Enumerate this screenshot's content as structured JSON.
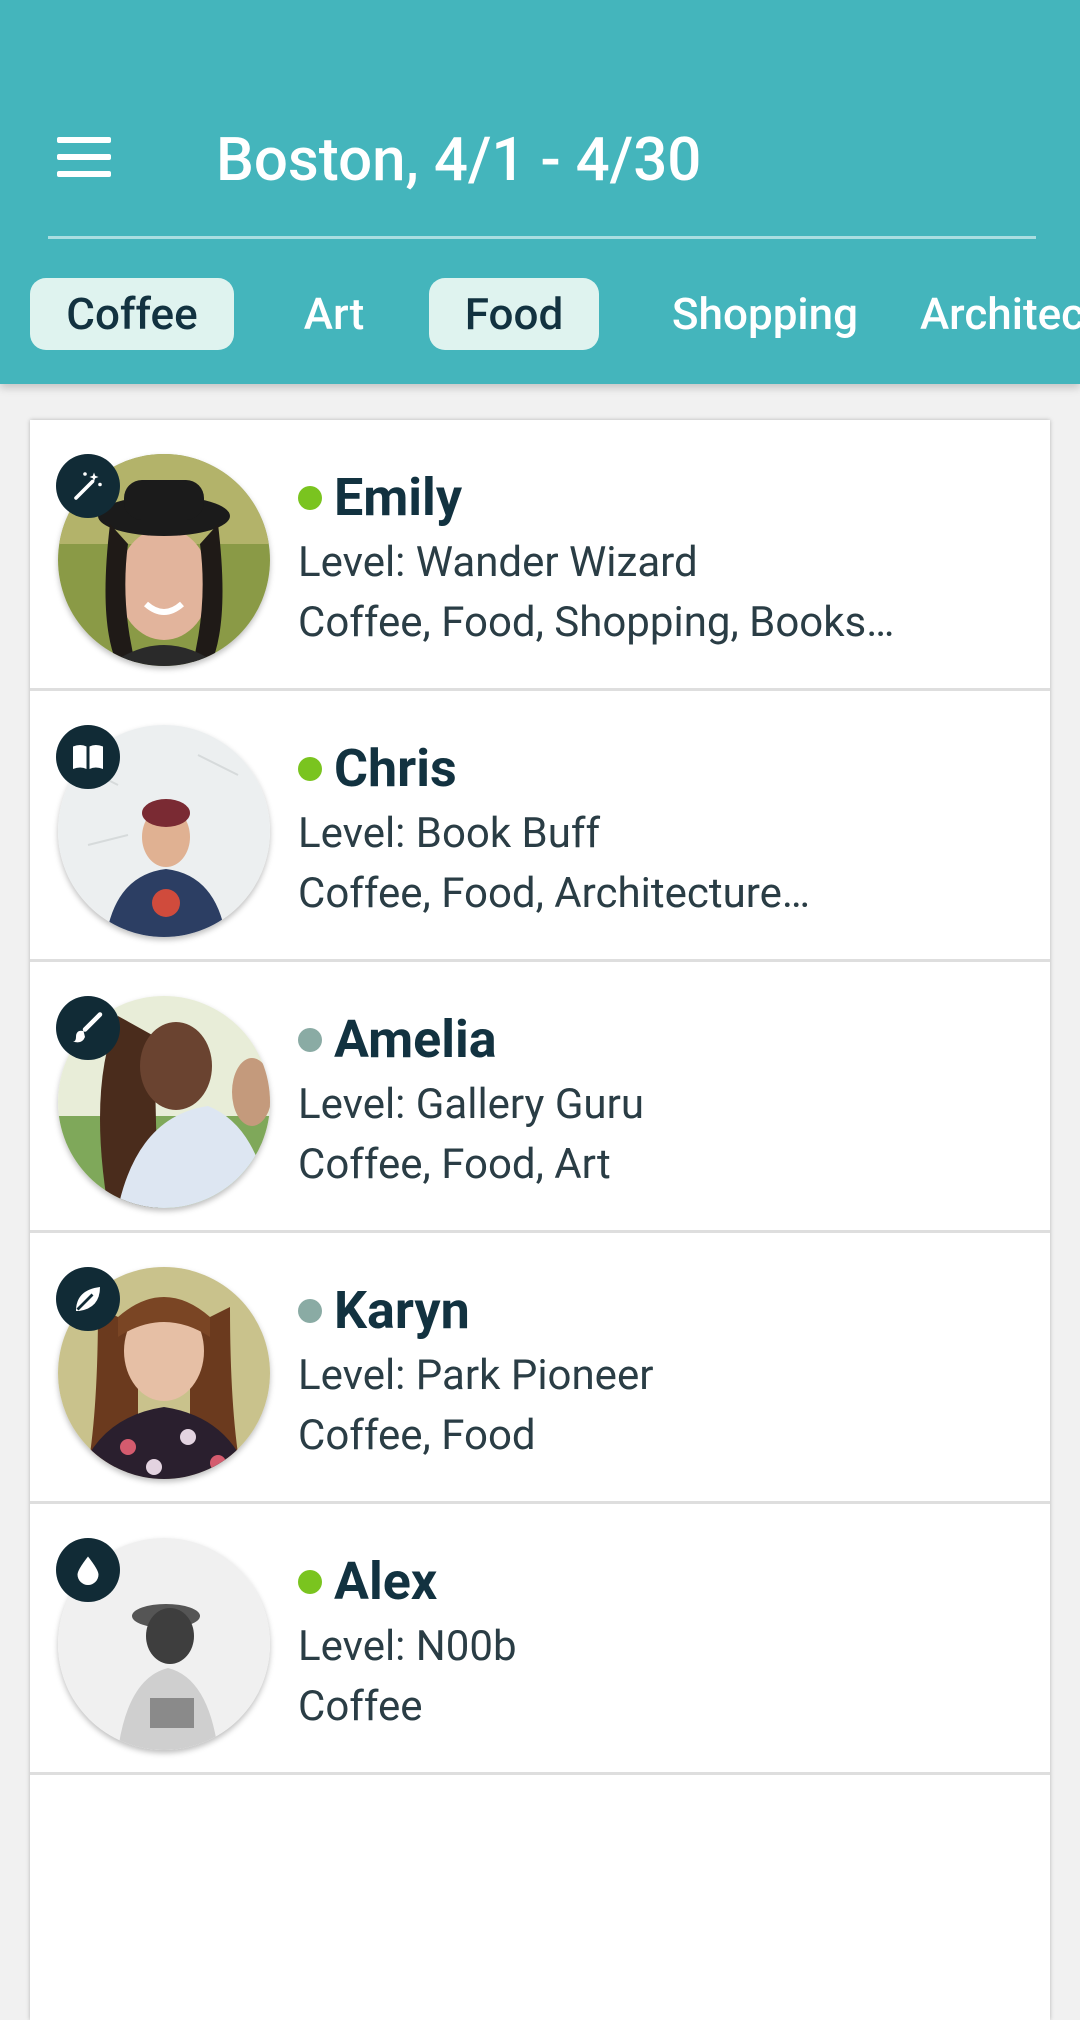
{
  "header": {
    "title": "Boston, 4/1 - 4/30",
    "menu_icon": "hamburger-menu-icon",
    "background_color": "#44b5bc"
  },
  "tabs": [
    {
      "label": "Coffee",
      "active": true
    },
    {
      "label": "Art",
      "active": false
    },
    {
      "label": "Food",
      "active": true
    },
    {
      "label": "Shopping",
      "active": false
    },
    {
      "label": "Architecture",
      "active": false
    }
  ],
  "status_colors": {
    "online": "#7ac41f",
    "offline": "#8aaba4"
  },
  "people": [
    {
      "name": "Emily",
      "status": "online",
      "level": "Level: Wander Wizard",
      "interests": "Coffee, Food, Shopping, Books…",
      "badge_icon": "magic-wand-icon"
    },
    {
      "name": "Chris",
      "status": "online",
      "level": "Level: Book Buff",
      "interests": "Coffee, Food, Architecture…",
      "badge_icon": "open-book-icon"
    },
    {
      "name": "Amelia",
      "status": "offline",
      "level": "Level: Gallery Guru",
      "interests": "Coffee, Food, Art",
      "badge_icon": "paintbrush-icon"
    },
    {
      "name": "Karyn",
      "status": "offline",
      "level": "Level: Park Pioneer",
      "interests": "Coffee, Food",
      "badge_icon": "leaf-icon"
    },
    {
      "name": "Alex",
      "status": "online",
      "level": "Level: N00b",
      "interests": "Coffee",
      "badge_icon": "droplet-icon"
    }
  ]
}
